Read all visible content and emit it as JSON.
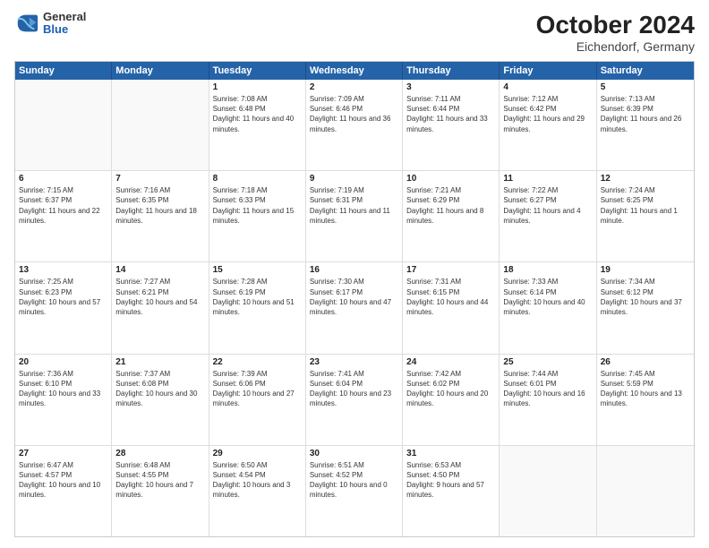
{
  "logo": {
    "general": "General",
    "blue": "Blue"
  },
  "title": {
    "month_year": "October 2024",
    "location": "Eichendorf, Germany"
  },
  "day_headers": [
    "Sunday",
    "Monday",
    "Tuesday",
    "Wednesday",
    "Thursday",
    "Friday",
    "Saturday"
  ],
  "weeks": [
    [
      {
        "num": "",
        "info": ""
      },
      {
        "num": "",
        "info": ""
      },
      {
        "num": "1",
        "info": "Sunrise: 7:08 AM\nSunset: 6:48 PM\nDaylight: 11 hours and 40 minutes."
      },
      {
        "num": "2",
        "info": "Sunrise: 7:09 AM\nSunset: 6:46 PM\nDaylight: 11 hours and 36 minutes."
      },
      {
        "num": "3",
        "info": "Sunrise: 7:11 AM\nSunset: 6:44 PM\nDaylight: 11 hours and 33 minutes."
      },
      {
        "num": "4",
        "info": "Sunrise: 7:12 AM\nSunset: 6:42 PM\nDaylight: 11 hours and 29 minutes."
      },
      {
        "num": "5",
        "info": "Sunrise: 7:13 AM\nSunset: 6:39 PM\nDaylight: 11 hours and 26 minutes."
      }
    ],
    [
      {
        "num": "6",
        "info": "Sunrise: 7:15 AM\nSunset: 6:37 PM\nDaylight: 11 hours and 22 minutes."
      },
      {
        "num": "7",
        "info": "Sunrise: 7:16 AM\nSunset: 6:35 PM\nDaylight: 11 hours and 18 minutes."
      },
      {
        "num": "8",
        "info": "Sunrise: 7:18 AM\nSunset: 6:33 PM\nDaylight: 11 hours and 15 minutes."
      },
      {
        "num": "9",
        "info": "Sunrise: 7:19 AM\nSunset: 6:31 PM\nDaylight: 11 hours and 11 minutes."
      },
      {
        "num": "10",
        "info": "Sunrise: 7:21 AM\nSunset: 6:29 PM\nDaylight: 11 hours and 8 minutes."
      },
      {
        "num": "11",
        "info": "Sunrise: 7:22 AM\nSunset: 6:27 PM\nDaylight: 11 hours and 4 minutes."
      },
      {
        "num": "12",
        "info": "Sunrise: 7:24 AM\nSunset: 6:25 PM\nDaylight: 11 hours and 1 minute."
      }
    ],
    [
      {
        "num": "13",
        "info": "Sunrise: 7:25 AM\nSunset: 6:23 PM\nDaylight: 10 hours and 57 minutes."
      },
      {
        "num": "14",
        "info": "Sunrise: 7:27 AM\nSunset: 6:21 PM\nDaylight: 10 hours and 54 minutes."
      },
      {
        "num": "15",
        "info": "Sunrise: 7:28 AM\nSunset: 6:19 PM\nDaylight: 10 hours and 51 minutes."
      },
      {
        "num": "16",
        "info": "Sunrise: 7:30 AM\nSunset: 6:17 PM\nDaylight: 10 hours and 47 minutes."
      },
      {
        "num": "17",
        "info": "Sunrise: 7:31 AM\nSunset: 6:15 PM\nDaylight: 10 hours and 44 minutes."
      },
      {
        "num": "18",
        "info": "Sunrise: 7:33 AM\nSunset: 6:14 PM\nDaylight: 10 hours and 40 minutes."
      },
      {
        "num": "19",
        "info": "Sunrise: 7:34 AM\nSunset: 6:12 PM\nDaylight: 10 hours and 37 minutes."
      }
    ],
    [
      {
        "num": "20",
        "info": "Sunrise: 7:36 AM\nSunset: 6:10 PM\nDaylight: 10 hours and 33 minutes."
      },
      {
        "num": "21",
        "info": "Sunrise: 7:37 AM\nSunset: 6:08 PM\nDaylight: 10 hours and 30 minutes."
      },
      {
        "num": "22",
        "info": "Sunrise: 7:39 AM\nSunset: 6:06 PM\nDaylight: 10 hours and 27 minutes."
      },
      {
        "num": "23",
        "info": "Sunrise: 7:41 AM\nSunset: 6:04 PM\nDaylight: 10 hours and 23 minutes."
      },
      {
        "num": "24",
        "info": "Sunrise: 7:42 AM\nSunset: 6:02 PM\nDaylight: 10 hours and 20 minutes."
      },
      {
        "num": "25",
        "info": "Sunrise: 7:44 AM\nSunset: 6:01 PM\nDaylight: 10 hours and 16 minutes."
      },
      {
        "num": "26",
        "info": "Sunrise: 7:45 AM\nSunset: 5:59 PM\nDaylight: 10 hours and 13 minutes."
      }
    ],
    [
      {
        "num": "27",
        "info": "Sunrise: 6:47 AM\nSunset: 4:57 PM\nDaylight: 10 hours and 10 minutes."
      },
      {
        "num": "28",
        "info": "Sunrise: 6:48 AM\nSunset: 4:55 PM\nDaylight: 10 hours and 7 minutes."
      },
      {
        "num": "29",
        "info": "Sunrise: 6:50 AM\nSunset: 4:54 PM\nDaylight: 10 hours and 3 minutes."
      },
      {
        "num": "30",
        "info": "Sunrise: 6:51 AM\nSunset: 4:52 PM\nDaylight: 10 hours and 0 minutes."
      },
      {
        "num": "31",
        "info": "Sunrise: 6:53 AM\nSunset: 4:50 PM\nDaylight: 9 hours and 57 minutes."
      },
      {
        "num": "",
        "info": ""
      },
      {
        "num": "",
        "info": ""
      }
    ]
  ]
}
